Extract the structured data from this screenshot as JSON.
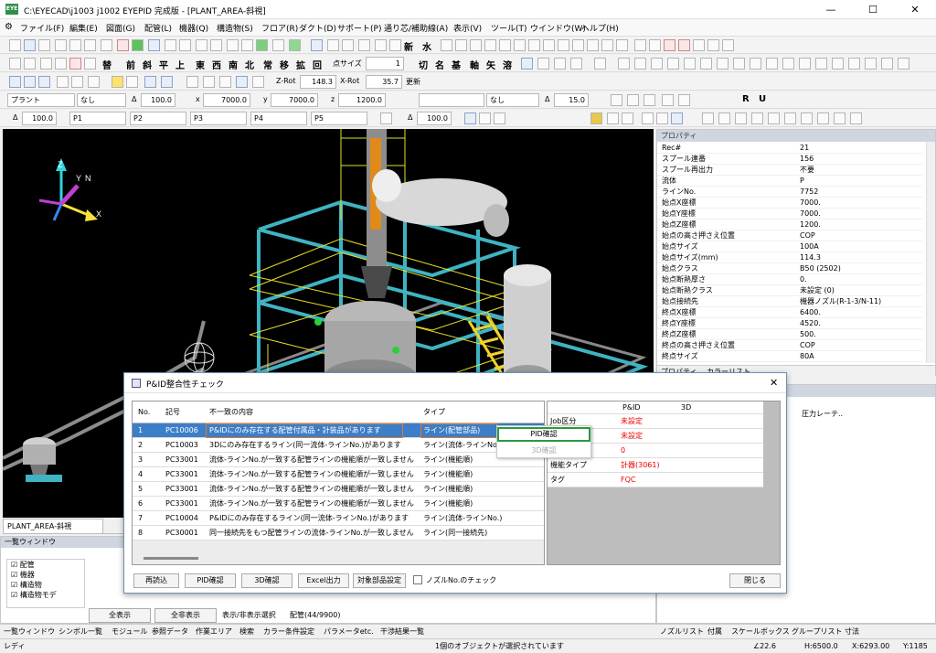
{
  "app": {
    "title": "C:\\EYECAD\\j1003 j1002 EYEPID 完成版 - [PLANT_AREA-斜視]",
    "logo": "EYE"
  },
  "window": {
    "minimize": "—",
    "maximize": "☐",
    "close": "✕"
  },
  "menu": [
    "ファイル(F)",
    "編集(E)",
    "図面(G)",
    "配管(L)",
    "機器(Q)",
    "構造物(S)",
    "フロア(R)",
    "ダクト(D)",
    "サポート(P)",
    "通り芯/補助線(A)",
    "表示(V)",
    "ツール(T)",
    "ウインドウ(W)",
    "ヘルプ(H)"
  ],
  "toolbar1": {
    "new_label": "新",
    "water_label": "水"
  },
  "toolbar2": {
    "chars": [
      "替",
      "前",
      "斜",
      "平",
      "上",
      "東",
      "西",
      "南",
      "北",
      "常",
      "移",
      "拡",
      "回"
    ],
    "point_size_label": "点サイズ",
    "point_size_value": "1",
    "chars2": [
      "切",
      "名",
      "基",
      "軸",
      "矢",
      "溶"
    ]
  },
  "toolbar3": {
    "zrot_label": "Z-Rot",
    "zrot_value": "148.3",
    "xrot_label": "X-Rot",
    "xrot_value": "35.7",
    "update_label": "更新"
  },
  "toolbar4": {
    "plant": "プラント",
    "none": "なし",
    "delta": "Δ",
    "delta_value": "100.0",
    "x_label": "x",
    "x_value": "7000.0",
    "y_label": "y",
    "y_value": "7000.0",
    "z_label": "z",
    "z_value": "1200.0",
    "none2": "なし",
    "delta2_value": "15.0"
  },
  "toolbar5": {
    "delta_value": "100.0",
    "p1": "P1",
    "p2": "P2",
    "p3": "P3",
    "p4": "P4",
    "p5": "P5",
    "delta2_value": "100.0"
  },
  "viewport": {
    "axis_z": "Z",
    "axis_y": "Y",
    "axis_n": "N",
    "axis_x": "X",
    "tab_label": "PLANT_AREA-斜視"
  },
  "properties": {
    "header": "プロパティ",
    "tab1": "プロパティ",
    "tab2": "カラーリスト",
    "rows": [
      [
        "Rec#",
        "21"
      ],
      [
        "スプール連番",
        "156"
      ],
      [
        "スプール再出力",
        "不要"
      ],
      [
        "流体",
        "P"
      ],
      [
        "ラインNo.",
        "7752"
      ],
      [
        "始点X座標",
        "7000."
      ],
      [
        "始点Y座標",
        "7000."
      ],
      [
        "始点Z座標",
        "1200."
      ],
      [
        "始点の高さ押さえ位置",
        "COP"
      ],
      [
        "始点サイズ",
        "100A"
      ],
      [
        "始点サイズ(mm)",
        "114.3"
      ],
      [
        "始点クラス",
        "B50 (2502)"
      ],
      [
        "始点断熱厚さ",
        "0."
      ],
      [
        "始点断熱クラス",
        "未設定 (0)"
      ],
      [
        "始点接続先",
        "機器ノズル(R-1-3/N-11)"
      ],
      [
        "終点X座標",
        "6400."
      ],
      [
        "終点Y座標",
        "4520."
      ],
      [
        "終点Z座標",
        "500."
      ],
      [
        "終点の高さ押さえ位置",
        "COP"
      ],
      [
        "終点サイズ",
        "80A"
      ]
    ]
  },
  "right_lower": {
    "col_header": "圧力レーテ.."
  },
  "right_tabs": [
    "ノズルリスト",
    "付属",
    "スケールボックス",
    "グループリスト",
    "寸法"
  ],
  "list_window": {
    "header": "一覧ウィンドウ",
    "items": [
      "配管",
      "機器",
      "構造物",
      "構造物モデ"
    ],
    "show_all": "全表示",
    "hide_all": "全非表示",
    "toggle_label": "表示/非表示選択",
    "count_label": "配管(44/9900)"
  },
  "lower_tabs": [
    "一覧ウィンドウ",
    "シンボル一覧",
    "モジュール",
    "参照データ",
    "作業エリア",
    "検索",
    "カラー条件設定",
    "パラメータetc.",
    "干渉結果一覧"
  ],
  "dialog": {
    "title": "P&ID整合性チェック",
    "close": "✕",
    "columns": {
      "no": "No.",
      "code": "記号",
      "content": "不一致の内容",
      "type": "タイプ"
    },
    "rows": [
      {
        "no": "1",
        "code": "PC10006",
        "content": "P&IDにのみ存在する配管付属品・計装品があります",
        "type": "ライン(配管部品)"
      },
      {
        "no": "2",
        "code": "PC10003",
        "content": "3Dにのみ存在するライン(同一流体-ラインNo.)があります",
        "type": "ライン(流体-ラインNo.)"
      },
      {
        "no": "3",
        "code": "PC33001",
        "content": "流体-ラインNo.が一致する配管ラインの機能順が一致しません",
        "type": "ライン(機能順)"
      },
      {
        "no": "4",
        "code": "PC33001",
        "content": "流体-ラインNo.が一致する配管ラインの機能順が一致しません",
        "type": "ライン(機能順)"
      },
      {
        "no": "5",
        "code": "PC33001",
        "content": "流体-ラインNo.が一致する配管ラインの機能順が一致しません",
        "type": "ライン(機能順)"
      },
      {
        "no": "6",
        "code": "PC33001",
        "content": "流体-ラインNo.が一致する配管ラインの機能順が一致しません",
        "type": "ライン(機能順)"
      },
      {
        "no": "7",
        "code": "PC10004",
        "content": "P&IDにのみ存在するライン(同一流体-ラインNo.)があります",
        "type": "ライン(流体-ラインNo.)"
      },
      {
        "no": "8",
        "code": "PC30001",
        "content": "同一接続先をもつ配管ラインの流体-ラインNo.が一致しません",
        "type": "ライン(同一接続先)"
      }
    ],
    "compare": {
      "col_pid": "P&ID",
      "col_3d": "3D",
      "rows": [
        [
          "Job区分",
          "未設定",
          ""
        ],
        [
          "",
          "未設定",
          ""
        ],
        [
          "",
          "0",
          ""
        ],
        [
          "機能タイプ",
          "計器(3061)",
          ""
        ],
        [
          "タグ",
          "FQC",
          ""
        ]
      ]
    },
    "buttons": {
      "reload": "再読込",
      "pid": "PID確認",
      "d3": "3D確認",
      "excel": "Excel出力",
      "target": "対象部品設定",
      "nozzle": "ノズルNo.のチェック",
      "close": "閉じる"
    },
    "context_menu": {
      "pid": "PID確認",
      "d3": "3D確認"
    }
  },
  "status": {
    "ready": "レディ",
    "message": "1個のオブジェクトが選択されています",
    "angle": "∠22.6",
    "h": "H:6500.0",
    "x": "X:6293.00",
    "y": "Y:1185"
  },
  "colors": {
    "accent": "#3c7ec8",
    "highlight": "#2a9a3c",
    "red": "#e00000"
  }
}
